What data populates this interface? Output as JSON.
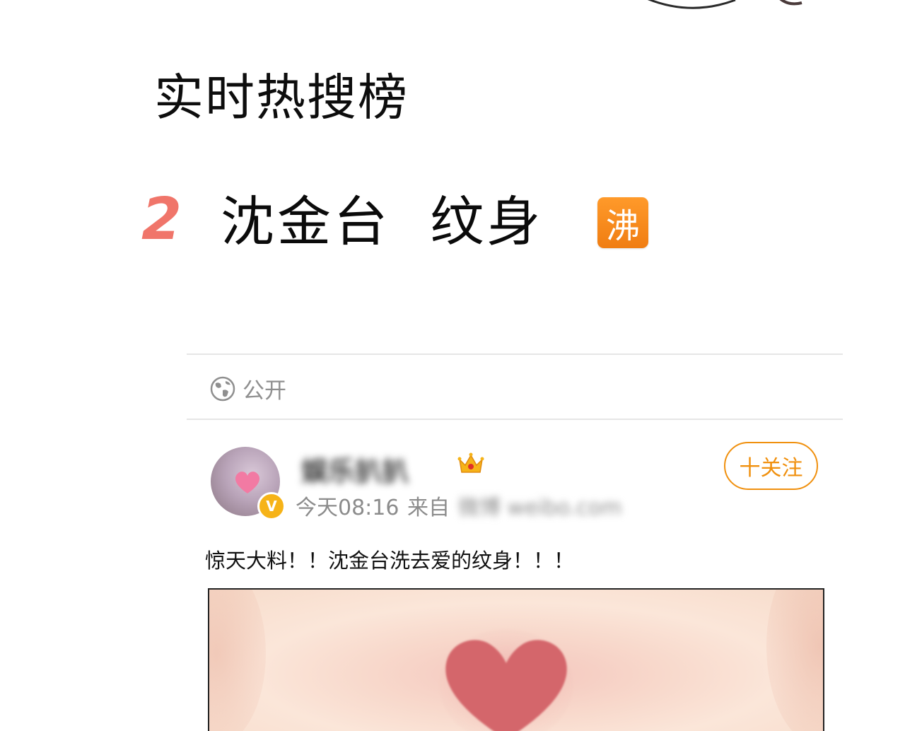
{
  "section": {
    "title": "实时热搜榜"
  },
  "hot_item": {
    "rank": "2",
    "topic": "沈金台  纹身",
    "badge": "沸"
  },
  "card": {
    "privacy": {
      "icon": "globe-icon",
      "label": "公开"
    },
    "post": {
      "username": "娱乐扒扒",
      "time": "今天08:16",
      "source_label": "来自",
      "source_value": "微博 weibo.com",
      "follow_label": "十关注",
      "text": "惊天大料！！沈金台洗去爱的纹身！！！",
      "verify_mark": "V"
    }
  },
  "colors": {
    "rank_color": "#f0756a",
    "badge_orange": "#f58a1f",
    "follow_orange": "#f0900e",
    "verify_gold": "#f6b318",
    "heart_red": "#d4666b"
  }
}
